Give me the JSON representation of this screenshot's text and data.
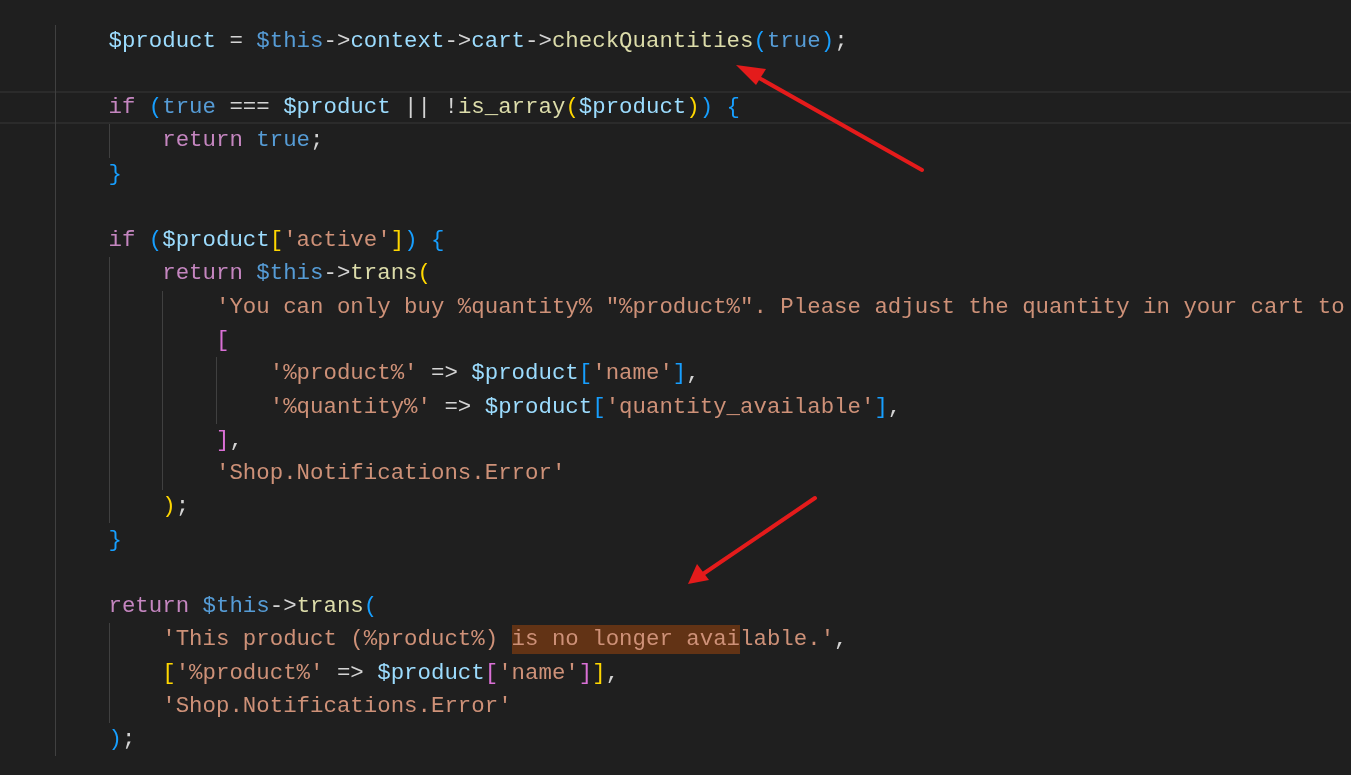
{
  "editor": {
    "lines": [
      {
        "current": false,
        "tokens": [
          {
            "kind": "var",
            "text": "        $product"
          },
          {
            "kind": "plain",
            "text": " = "
          },
          {
            "kind": "const",
            "text": "$this"
          },
          {
            "kind": "plain",
            "text": "->"
          },
          {
            "kind": "var",
            "text": "context"
          },
          {
            "kind": "plain",
            "text": "->"
          },
          {
            "kind": "var",
            "text": "cart"
          },
          {
            "kind": "plain",
            "text": "->"
          },
          {
            "kind": "fn",
            "text": "checkQuantities"
          },
          {
            "kind": "b3",
            "text": "("
          },
          {
            "kind": "const",
            "text": "true"
          },
          {
            "kind": "b3",
            "text": ")"
          },
          {
            "kind": "plain",
            "text": ";"
          }
        ]
      },
      {
        "current": false,
        "kind": "blank"
      },
      {
        "current": true,
        "tokens": [
          {
            "kind": "kw",
            "text": "        if "
          },
          {
            "kind": "b3",
            "text": "("
          },
          {
            "kind": "const",
            "text": "true"
          },
          {
            "kind": "plain",
            "text": " === "
          },
          {
            "kind": "var",
            "text": "$product"
          },
          {
            "kind": "plain",
            "text": " || !"
          },
          {
            "kind": "fn",
            "text": "is_array"
          },
          {
            "kind": "b1",
            "text": "("
          },
          {
            "kind": "var",
            "text": "$product"
          },
          {
            "kind": "b1",
            "text": ")"
          },
          {
            "kind": "b3",
            "text": ")"
          },
          {
            "kind": "b3",
            "text": " {"
          }
        ]
      },
      {
        "current": false,
        "tokens": [
          {
            "kind": "kw",
            "text": "            return "
          },
          {
            "kind": "const",
            "text": "true"
          },
          {
            "kind": "plain",
            "text": ";"
          }
        ]
      },
      {
        "current": false,
        "tokens": [
          {
            "kind": "b3",
            "text": "        }"
          }
        ]
      },
      {
        "current": false,
        "kind": "blank"
      },
      {
        "current": false,
        "tokens": [
          {
            "kind": "kw",
            "text": "        if "
          },
          {
            "kind": "b3",
            "text": "("
          },
          {
            "kind": "var",
            "text": "$product"
          },
          {
            "kind": "b1",
            "text": "["
          },
          {
            "kind": "str",
            "text": "'active'"
          },
          {
            "kind": "b1",
            "text": "]"
          },
          {
            "kind": "b3",
            "text": ")"
          },
          {
            "kind": "b3",
            "text": " {"
          }
        ]
      },
      {
        "current": false,
        "tokens": [
          {
            "kind": "kw",
            "text": "            return "
          },
          {
            "kind": "const",
            "text": "$this"
          },
          {
            "kind": "plain",
            "text": "->"
          },
          {
            "kind": "fn",
            "text": "trans"
          },
          {
            "kind": "b1",
            "text": "("
          }
        ]
      },
      {
        "current": false,
        "tokens": [
          {
            "kind": "str",
            "text": "                'You can only buy %quantity% \"%product%\". Please adjust the quantity in your cart to"
          }
        ]
      },
      {
        "current": false,
        "tokens": [
          {
            "kind": "b2",
            "text": "                ["
          }
        ]
      },
      {
        "current": false,
        "tokens": [
          {
            "kind": "str",
            "text": "                    '%product%'"
          },
          {
            "kind": "plain",
            "text": " => "
          },
          {
            "kind": "var",
            "text": "$product"
          },
          {
            "kind": "b3",
            "text": "["
          },
          {
            "kind": "str",
            "text": "'name'"
          },
          {
            "kind": "b3",
            "text": "]"
          },
          {
            "kind": "plain",
            "text": ","
          }
        ]
      },
      {
        "current": false,
        "tokens": [
          {
            "kind": "str",
            "text": "                    '%quantity%'"
          },
          {
            "kind": "plain",
            "text": " => "
          },
          {
            "kind": "var",
            "text": "$product"
          },
          {
            "kind": "b3",
            "text": "["
          },
          {
            "kind": "str",
            "text": "'quantity_available'"
          },
          {
            "kind": "b3",
            "text": "]"
          },
          {
            "kind": "plain",
            "text": ","
          }
        ]
      },
      {
        "current": false,
        "tokens": [
          {
            "kind": "b2",
            "text": "                ]"
          },
          {
            "kind": "plain",
            "text": ","
          }
        ]
      },
      {
        "current": false,
        "tokens": [
          {
            "kind": "str",
            "text": "                'Shop.Notifications.Error'"
          }
        ]
      },
      {
        "current": false,
        "tokens": [
          {
            "kind": "b1",
            "text": "            )"
          },
          {
            "kind": "plain",
            "text": ";"
          }
        ]
      },
      {
        "current": false,
        "tokens": [
          {
            "kind": "b3",
            "text": "        }"
          }
        ]
      },
      {
        "current": false,
        "kind": "blank"
      },
      {
        "current": false,
        "tokens": [
          {
            "kind": "kw",
            "text": "        return "
          },
          {
            "kind": "const",
            "text": "$this"
          },
          {
            "kind": "plain",
            "text": "->"
          },
          {
            "kind": "fn",
            "text": "trans"
          },
          {
            "kind": "b3",
            "text": "("
          }
        ]
      },
      {
        "current": false,
        "tokens": [
          {
            "kind": "str",
            "text": "            'This product (%product%) "
          },
          {
            "kind": "str",
            "text": "is no longer avai",
            "highlight": true
          },
          {
            "kind": "str",
            "text": "lable.'"
          },
          {
            "kind": "plain",
            "text": ","
          }
        ]
      },
      {
        "current": false,
        "tokens": [
          {
            "kind": "b1",
            "text": "            ["
          },
          {
            "kind": "str",
            "text": "'%product%'"
          },
          {
            "kind": "plain",
            "text": " => "
          },
          {
            "kind": "var",
            "text": "$product"
          },
          {
            "kind": "b2",
            "text": "["
          },
          {
            "kind": "str",
            "text": "'name'"
          },
          {
            "kind": "b2",
            "text": "]"
          },
          {
            "kind": "b1",
            "text": "]"
          },
          {
            "kind": "plain",
            "text": ","
          }
        ]
      },
      {
        "current": false,
        "tokens": [
          {
            "kind": "str",
            "text": "            'Shop.Notifications.Error'"
          }
        ]
      },
      {
        "current": false,
        "tokens": [
          {
            "kind": "b3",
            "text": "        )"
          },
          {
            "kind": "plain",
            "text": ";"
          }
        ]
      }
    ]
  }
}
